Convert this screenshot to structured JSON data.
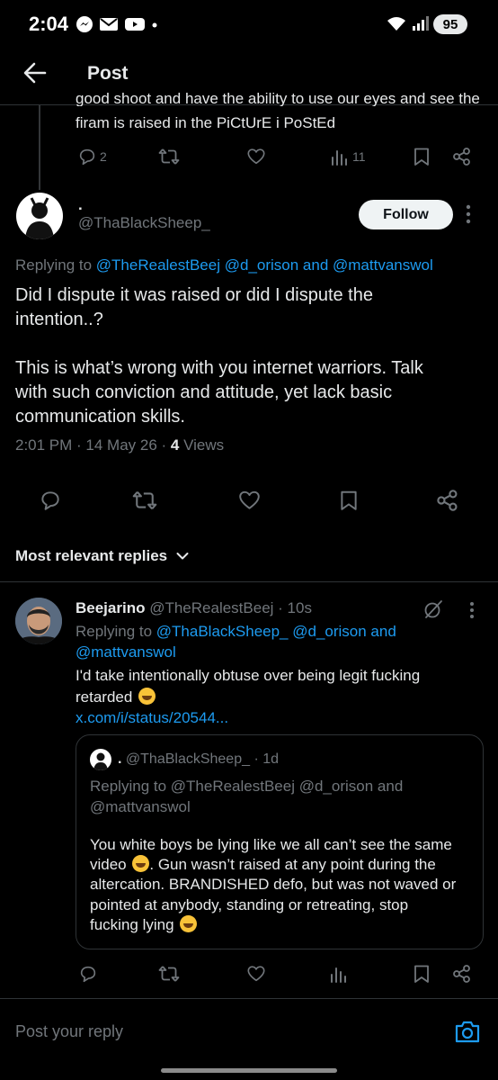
{
  "status_bar": {
    "time": "2:04",
    "battery": "95"
  },
  "header": {
    "title": "Post"
  },
  "prev_tweet": {
    "line1": "good shoot and have the ability to use our eyes and see the",
    "line2": "firam is raised in the PiCtUrE i PoStEd",
    "replies": "2",
    "views": "11"
  },
  "main_tweet": {
    "name": ".",
    "handle": "@ThaBlackSheep_",
    "follow_label": "Follow",
    "replying_prefix": "Replying to ",
    "replying_user1": "@TheRealestBeej",
    "replying_user2": "@d_orison",
    "replying_and": " and ",
    "replying_user3": "@mattvanswol",
    "text_line1": "Did I dispute it was raised or did I dispute the",
    "text_line2": "intention..?",
    "text_line3": "This is what’s wrong with you internet warriors. Talk",
    "text_line4": "with such conviction and attitude, yet lack basic",
    "text_line5": "communication skills.",
    "time": "2:01 PM · 14 May 26 · ",
    "views_count": "4",
    "views_label": " Views"
  },
  "sort": {
    "label": "Most relevant replies"
  },
  "reply": {
    "name": "Beejarino",
    "handle": " @TheRealestBeej · 10s",
    "replying_prefix": "Replying to ",
    "replying_user1": "@ThaBlackSheep_",
    "replying_user2": " @d_orison and",
    "replying_user3": "@mattvanswol",
    "text_line1": "I'd take intentionally obtuse over being legit fucking",
    "text_line2": "retarded",
    "link": "x.com/i/status/20544...",
    "quote": {
      "name": ".",
      "handle": " @ThaBlackSheep_ · 1d",
      "replying_line1": "Replying to @TheRealestBeej @d_orison and",
      "replying_line2": "@mattvanswol",
      "text_line1": "You white boys be lying like we all can’t see the same",
      "text_line2": "video",
      "text_line2b": ". Gun wasn’t raised at any point during the",
      "text_line3": "altercation. BRANDISHED defo, but was not waved or",
      "text_line4": "pointed at anybody, standing or retreating, stop",
      "text_line5": "fucking lying"
    }
  },
  "composer": {
    "placeholder": "Post your reply"
  },
  "colors": {
    "accent": "#1d9bf0",
    "background": "#000000",
    "text": "#e7e9ea",
    "muted": "#71767b"
  }
}
